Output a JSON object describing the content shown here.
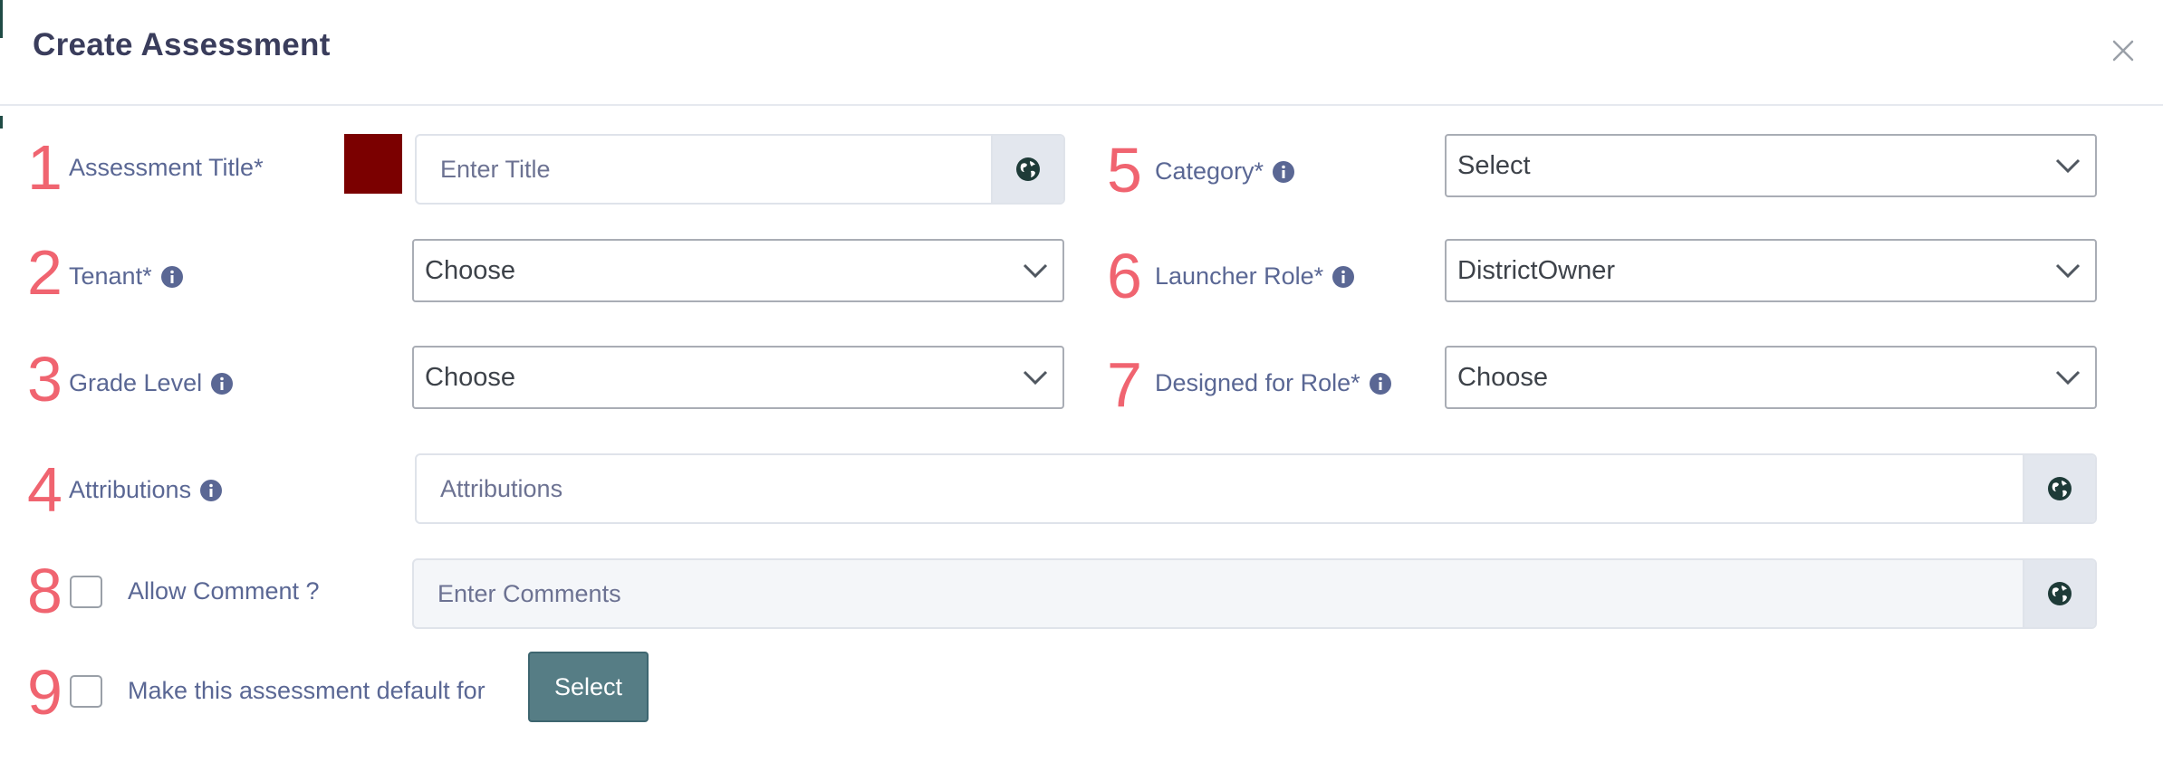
{
  "modal": {
    "title": "Create Assessment"
  },
  "fields": {
    "title": {
      "number": "1",
      "label": "Assessment Title*",
      "placeholder": "Enter Title",
      "swatch_color": "#7b0000"
    },
    "tenant": {
      "number": "2",
      "label": "Tenant*",
      "value": "Choose"
    },
    "grade": {
      "number": "3",
      "label": "Grade Level",
      "value": "Choose"
    },
    "attributions": {
      "number": "4",
      "label": "Attributions",
      "placeholder": "Attributions"
    },
    "category": {
      "number": "5",
      "label": "Category*",
      "value": "Select"
    },
    "launcher": {
      "number": "6",
      "label": "Launcher Role*",
      "value": "DistrictOwner"
    },
    "designed": {
      "number": "7",
      "label": "Designed for Role*",
      "value": "Choose"
    },
    "comment": {
      "number": "8",
      "label": "Allow Comment ?",
      "placeholder": "Enter Comments"
    },
    "default": {
      "number": "9",
      "label": "Make this assessment default for",
      "button_label": "Select"
    }
  },
  "icons": {
    "close": "close-icon",
    "globe": "globe-icon",
    "info": "info-icon",
    "chevron": "chevron-down-icon"
  },
  "colors": {
    "number_accent": "#f06470",
    "label": "#5a6794",
    "select_button": "#567d85"
  }
}
